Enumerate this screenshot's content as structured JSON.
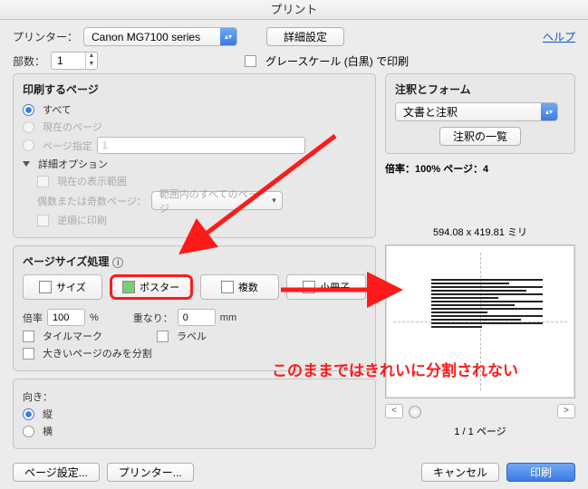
{
  "title": "プリント",
  "toolbar": {
    "printer_label": "プリンター：",
    "printer_value": "Canon MG7100 series",
    "advanced": "詳細設定",
    "help": "ヘルプ",
    "copies_label": "部数：",
    "copies_value": "1",
    "grayscale": "グレースケール (白黒) で印刷"
  },
  "range": {
    "heading": "印刷するページ",
    "all": "すべて",
    "current": "現在のページ",
    "specify": "ページ指定",
    "specify_value": "1",
    "adv_opt": "詳細オプション",
    "current_view": "現在の表示範囲",
    "oddeven_label": "偶数または奇数ページ：",
    "oddeven_value": "範囲内のすべてのページ",
    "reverse": "逆順に印刷"
  },
  "sizing": {
    "heading": "ページサイズ処理",
    "tabs": {
      "size": "サイズ",
      "poster": "ポスター",
      "multi": "複数",
      "book": "小冊子"
    },
    "scale_label": "倍率",
    "scale_value": "100",
    "scale_unit": "%",
    "overlap_label": "重なり：",
    "overlap_value": "0",
    "overlap_unit": "mm",
    "tile_mark": "タイルマーク",
    "label_chk": "ラベル",
    "split_large": "大きいページのみを分割"
  },
  "orient": {
    "heading": "向き：",
    "portrait": "縦",
    "landscape": "横"
  },
  "annot": {
    "heading": "注釈とフォーム",
    "select_value": "文書と注釈",
    "list_btn": "注釈の一覧",
    "info": "倍率：100% ページ：4",
    "dims": "594.08 x 419.81 ミリ",
    "pager": "1 / 1 ページ"
  },
  "footer": {
    "page_setup": "ページ設定...",
    "printer_btn": "プリンター...",
    "cancel": "キャンセル",
    "print": "印刷"
  },
  "callout": "このままではきれいに分割されない"
}
